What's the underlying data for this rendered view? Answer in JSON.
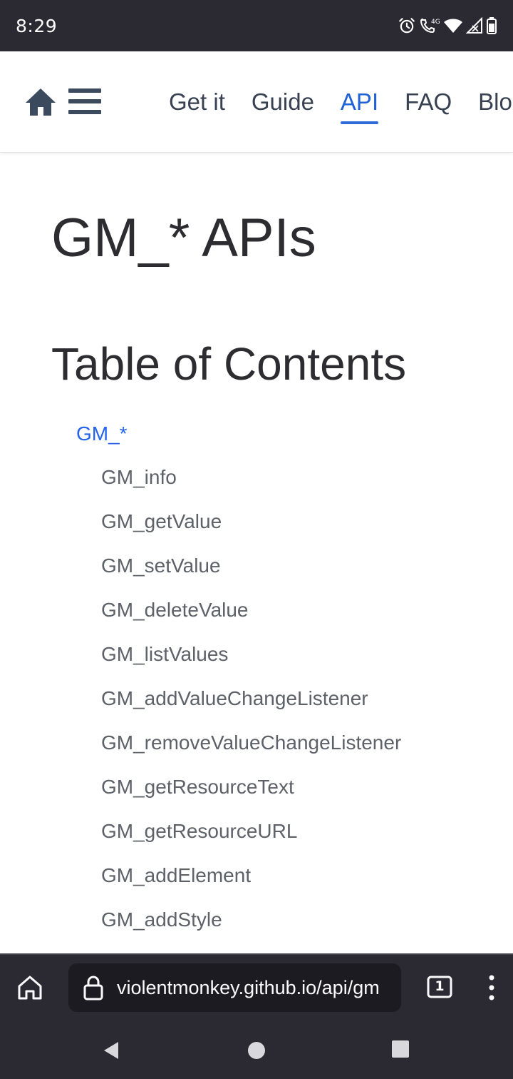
{
  "status_bar": {
    "time": "8:29",
    "network_label": "4G",
    "icons": [
      "alarm-icon",
      "wifi-calling-icon",
      "wifi-icon",
      "signal-icon",
      "battery-icon"
    ]
  },
  "site_header": {
    "nav_items": [
      "Get it",
      "Guide",
      "API",
      "FAQ",
      "Blo"
    ],
    "active_item": "API",
    "icons": [
      "home-icon",
      "menu-icon"
    ],
    "colors": {
      "active": "#1f62d6",
      "text": "#374151"
    }
  },
  "content": {
    "page_title": "GM_* APIs",
    "toc_heading": "Table of Contents",
    "toc_root": "GM_*",
    "toc_items": [
      "GM_info",
      "GM_getValue",
      "GM_setValue",
      "GM_deleteValue",
      "GM_listValues",
      "GM_addValueChangeListener",
      "GM_removeValueChangeListener",
      "GM_getResourceText",
      "GM_getResourceURL",
      "GM_addElement",
      "GM_addStyle"
    ],
    "colors": {
      "link": "#2563eb",
      "toc_item": "#5d6168"
    }
  },
  "browser_bar": {
    "url": "violentmonkey.github.io/api/gm",
    "tab_count": "1",
    "icons": [
      "home-icon",
      "lock-icon",
      "tabs-icon",
      "more-options-icon"
    ]
  },
  "android_nav": {
    "icons": [
      "back-icon",
      "home-circle-icon",
      "recents-icon"
    ]
  }
}
